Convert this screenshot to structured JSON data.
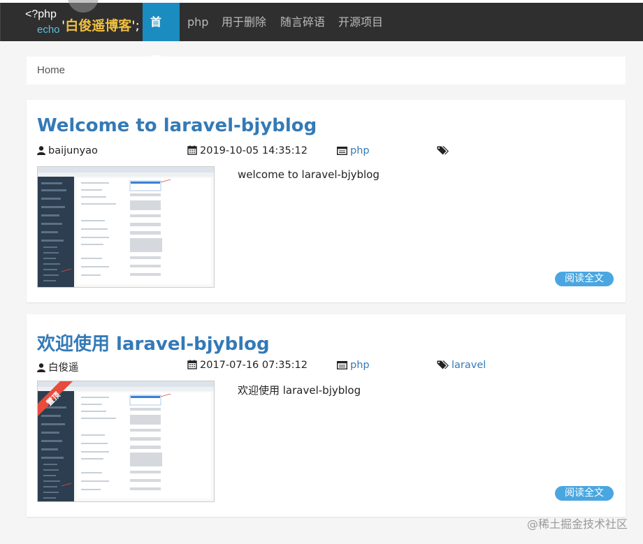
{
  "brand": {
    "line1": "<?php",
    "line2": "echo",
    "quote_open": "'",
    "name": "白俊遥博客",
    "quote_close": "';"
  },
  "nav": {
    "items": [
      {
        "label": "首页",
        "active": true
      },
      {
        "label": "php"
      },
      {
        "label": "用于删除"
      },
      {
        "label": "随言碎语"
      },
      {
        "label": "开源项目"
      }
    ]
  },
  "breadcrumb": "Home",
  "posts": [
    {
      "title": "Welcome to laravel-bjyblog",
      "author": "baijunyao",
      "date": "2019-10-05 14:35:12",
      "category": "php",
      "tags": "",
      "excerpt": "welcome to laravel-bjyblog",
      "read_more": "阅读全文",
      "pinned": false
    },
    {
      "title": "欢迎使用 laravel-bjyblog",
      "author": "白俊遥",
      "date": "2017-07-16 07:35:12",
      "category": "php",
      "tags": "laravel",
      "excerpt": "欢迎使用 laravel-bjyblog",
      "read_more": "阅读全文",
      "pinned": true,
      "pinned_label": "置顶"
    }
  ],
  "watermark": "@稀土掘金技术社区",
  "icons": {
    "author": "user-icon",
    "date": "calendar-icon",
    "category": "folder-icon",
    "tags": "tags-icon"
  },
  "colors": {
    "navbar": "#2f2f2f",
    "active": "#1a8cbf",
    "link": "#337ab7",
    "brand_name": "#f0c040",
    "button": "#4aa6e0",
    "pin_ribbon": "#e74c3c"
  }
}
